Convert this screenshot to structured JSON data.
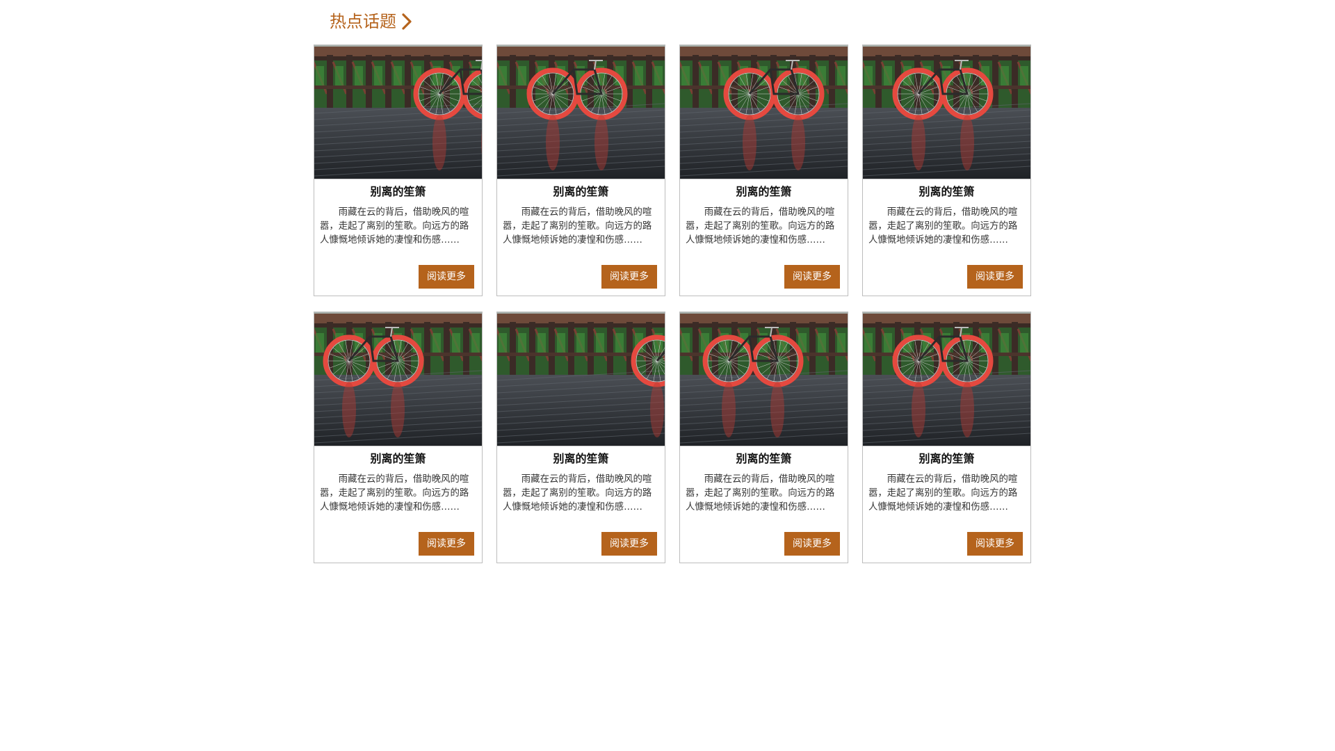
{
  "section": {
    "title": "热点话题",
    "icon": "chevron-right-icon",
    "accent_color": "#b5631c"
  },
  "cards": [
    {
      "title": "别离的笙箫",
      "desc": "雨藏在云的背后，借助晚风的喧嚣，走起了离别的笙歌。向远方的路人慷慨地倾诉她的凄惶和伤感……",
      "button": "阅读更多",
      "image": "bicycle-on-wet-bridge-photo"
    },
    {
      "title": "别离的笙箫",
      "desc": "雨藏在云的背后，借助晚风的喧嚣，走起了离别的笙歌。向远方的路人慷慨地倾诉她的凄惶和伤感……",
      "button": "阅读更多",
      "image": "bicycle-on-wet-bridge-photo"
    },
    {
      "title": "别离的笙箫",
      "desc": "雨藏在云的背后，借助晚风的喧嚣，走起了离别的笙歌。向远方的路人慷慨地倾诉她的凄惶和伤感……",
      "button": "阅读更多",
      "image": "bicycle-on-wet-bridge-photo"
    },
    {
      "title": "别离的笙箫",
      "desc": "雨藏在云的背后，借助晚风的喧嚣，走起了离别的笙歌。向远方的路人慷慨地倾诉她的凄惶和伤感……",
      "button": "阅读更多",
      "image": "bicycle-on-wet-bridge-photo"
    },
    {
      "title": "别离的笙箫",
      "desc": "雨藏在云的背后，借助晚风的喧嚣，走起了离别的笙歌。向远方的路人慷慨地倾诉她的凄惶和伤感……",
      "button": "阅读更多",
      "image": "bicycle-on-wet-bridge-photo"
    },
    {
      "title": "别离的笙箫",
      "desc": "雨藏在云的背后，借助晚风的喧嚣，走起了离别的笙歌。向远方的路人慷慨地倾诉她的凄惶和伤感……",
      "button": "阅读更多",
      "image": "bicycle-on-wet-bridge-photo"
    },
    {
      "title": "别离的笙箫",
      "desc": "雨藏在云的背后，借助晚风的喧嚣，走起了离别的笙歌。向远方的路人慷慨地倾诉她的凄惶和伤感……",
      "button": "阅读更多",
      "image": "bicycle-on-wet-bridge-photo"
    },
    {
      "title": "别离的笙箫",
      "desc": "雨藏在云的背后，借助晚风的喧嚣，走起了离别的笙歌。向远方的路人慷慨地倾诉她的凄惶和伤感……",
      "button": "阅读更多",
      "image": "bicycle-on-wet-bridge-photo"
    }
  ]
}
